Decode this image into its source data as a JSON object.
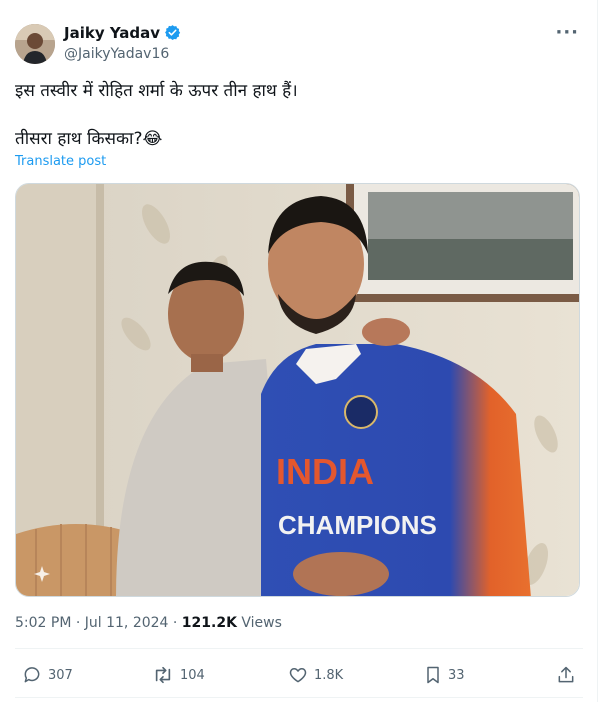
{
  "author": {
    "name": "Jaiky Yadav",
    "handle": "@JaikyYadav16",
    "verified": true
  },
  "menu_icon": "more-horizontal-icon",
  "post": {
    "text_line1": "इस तस्वीर में रोहित शर्मा के ऊपर तीन हाथ हैं।",
    "text_line2": "तीसरा हाथ किसका?😂",
    "translate_label": "Translate post"
  },
  "photo": {
    "jersey_text1": "INDIA",
    "jersey_text2": "CHAMPIONS"
  },
  "meta": {
    "time_date": "5:02 PM · Jul 11, 2024 · ",
    "views_count": "121.2K",
    "views_label": " Views"
  },
  "actions": {
    "replies": "307",
    "reposts": "104",
    "likes": "1.8K",
    "bookmarks": "33"
  },
  "colors": {
    "accent": "#1d9bf0",
    "muted": "#536471",
    "text": "#0f1419"
  }
}
